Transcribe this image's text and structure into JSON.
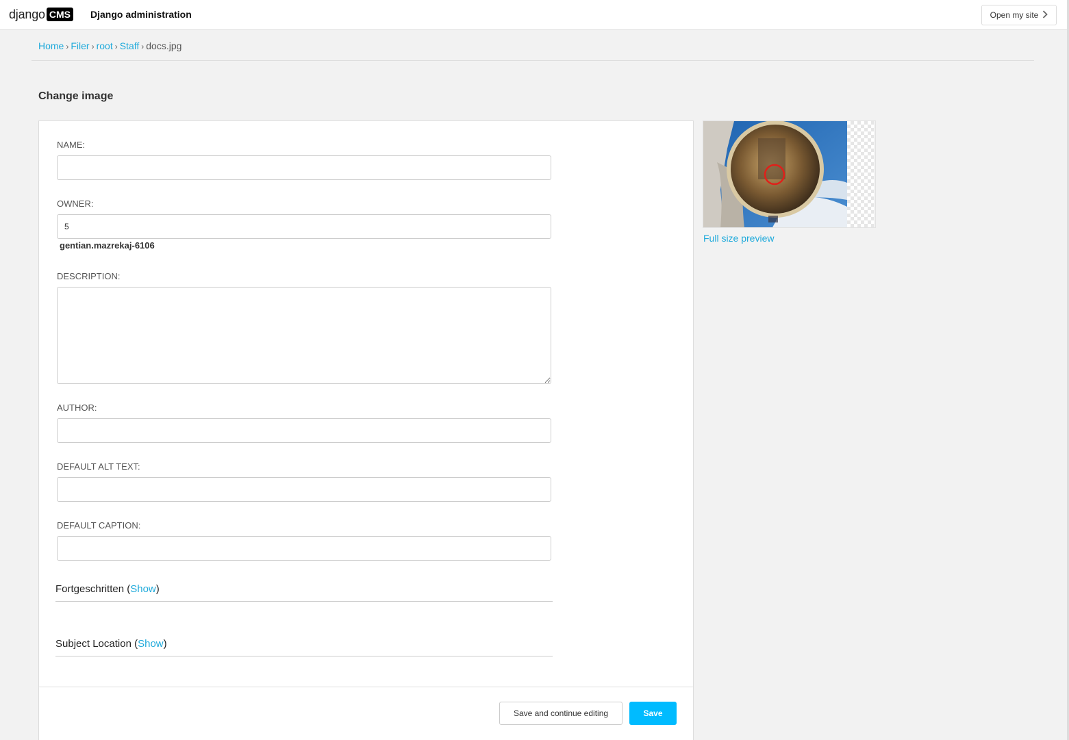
{
  "header": {
    "logo_word": "django",
    "logo_badge": "CMS",
    "title": "Django administration",
    "open_site_label": "Open my site"
  },
  "breadcrumb": {
    "items": [
      "Home",
      "Filer",
      "root",
      "Staff"
    ],
    "current": "docs.jpg",
    "separator": "›"
  },
  "page_title": "Change image",
  "form": {
    "name": {
      "label": "NAME:",
      "value": ""
    },
    "owner": {
      "label": "OWNER:",
      "value": "5",
      "display_name": "gentian.mazrekaj-6106"
    },
    "description": {
      "label": "DESCRIPTION:",
      "value": ""
    },
    "author": {
      "label": "AUTHOR:",
      "value": ""
    },
    "default_alt_text": {
      "label": "DEFAULT ALT TEXT:",
      "value": ""
    },
    "default_caption": {
      "label": "DEFAULT CAPTION:",
      "value": ""
    },
    "fieldsets": [
      {
        "title": "Fortgeschritten",
        "toggle_label": "Show"
      },
      {
        "title": "Subject Location",
        "toggle_label": "Show"
      }
    ],
    "buttons": {
      "save_continue": "Save and continue editing",
      "save": "Save"
    }
  },
  "preview": {
    "link_label": "Full size preview",
    "colors": {
      "accent": "#1faadb",
      "primary_button": "#00bbff",
      "marker": "#e0201a"
    }
  }
}
